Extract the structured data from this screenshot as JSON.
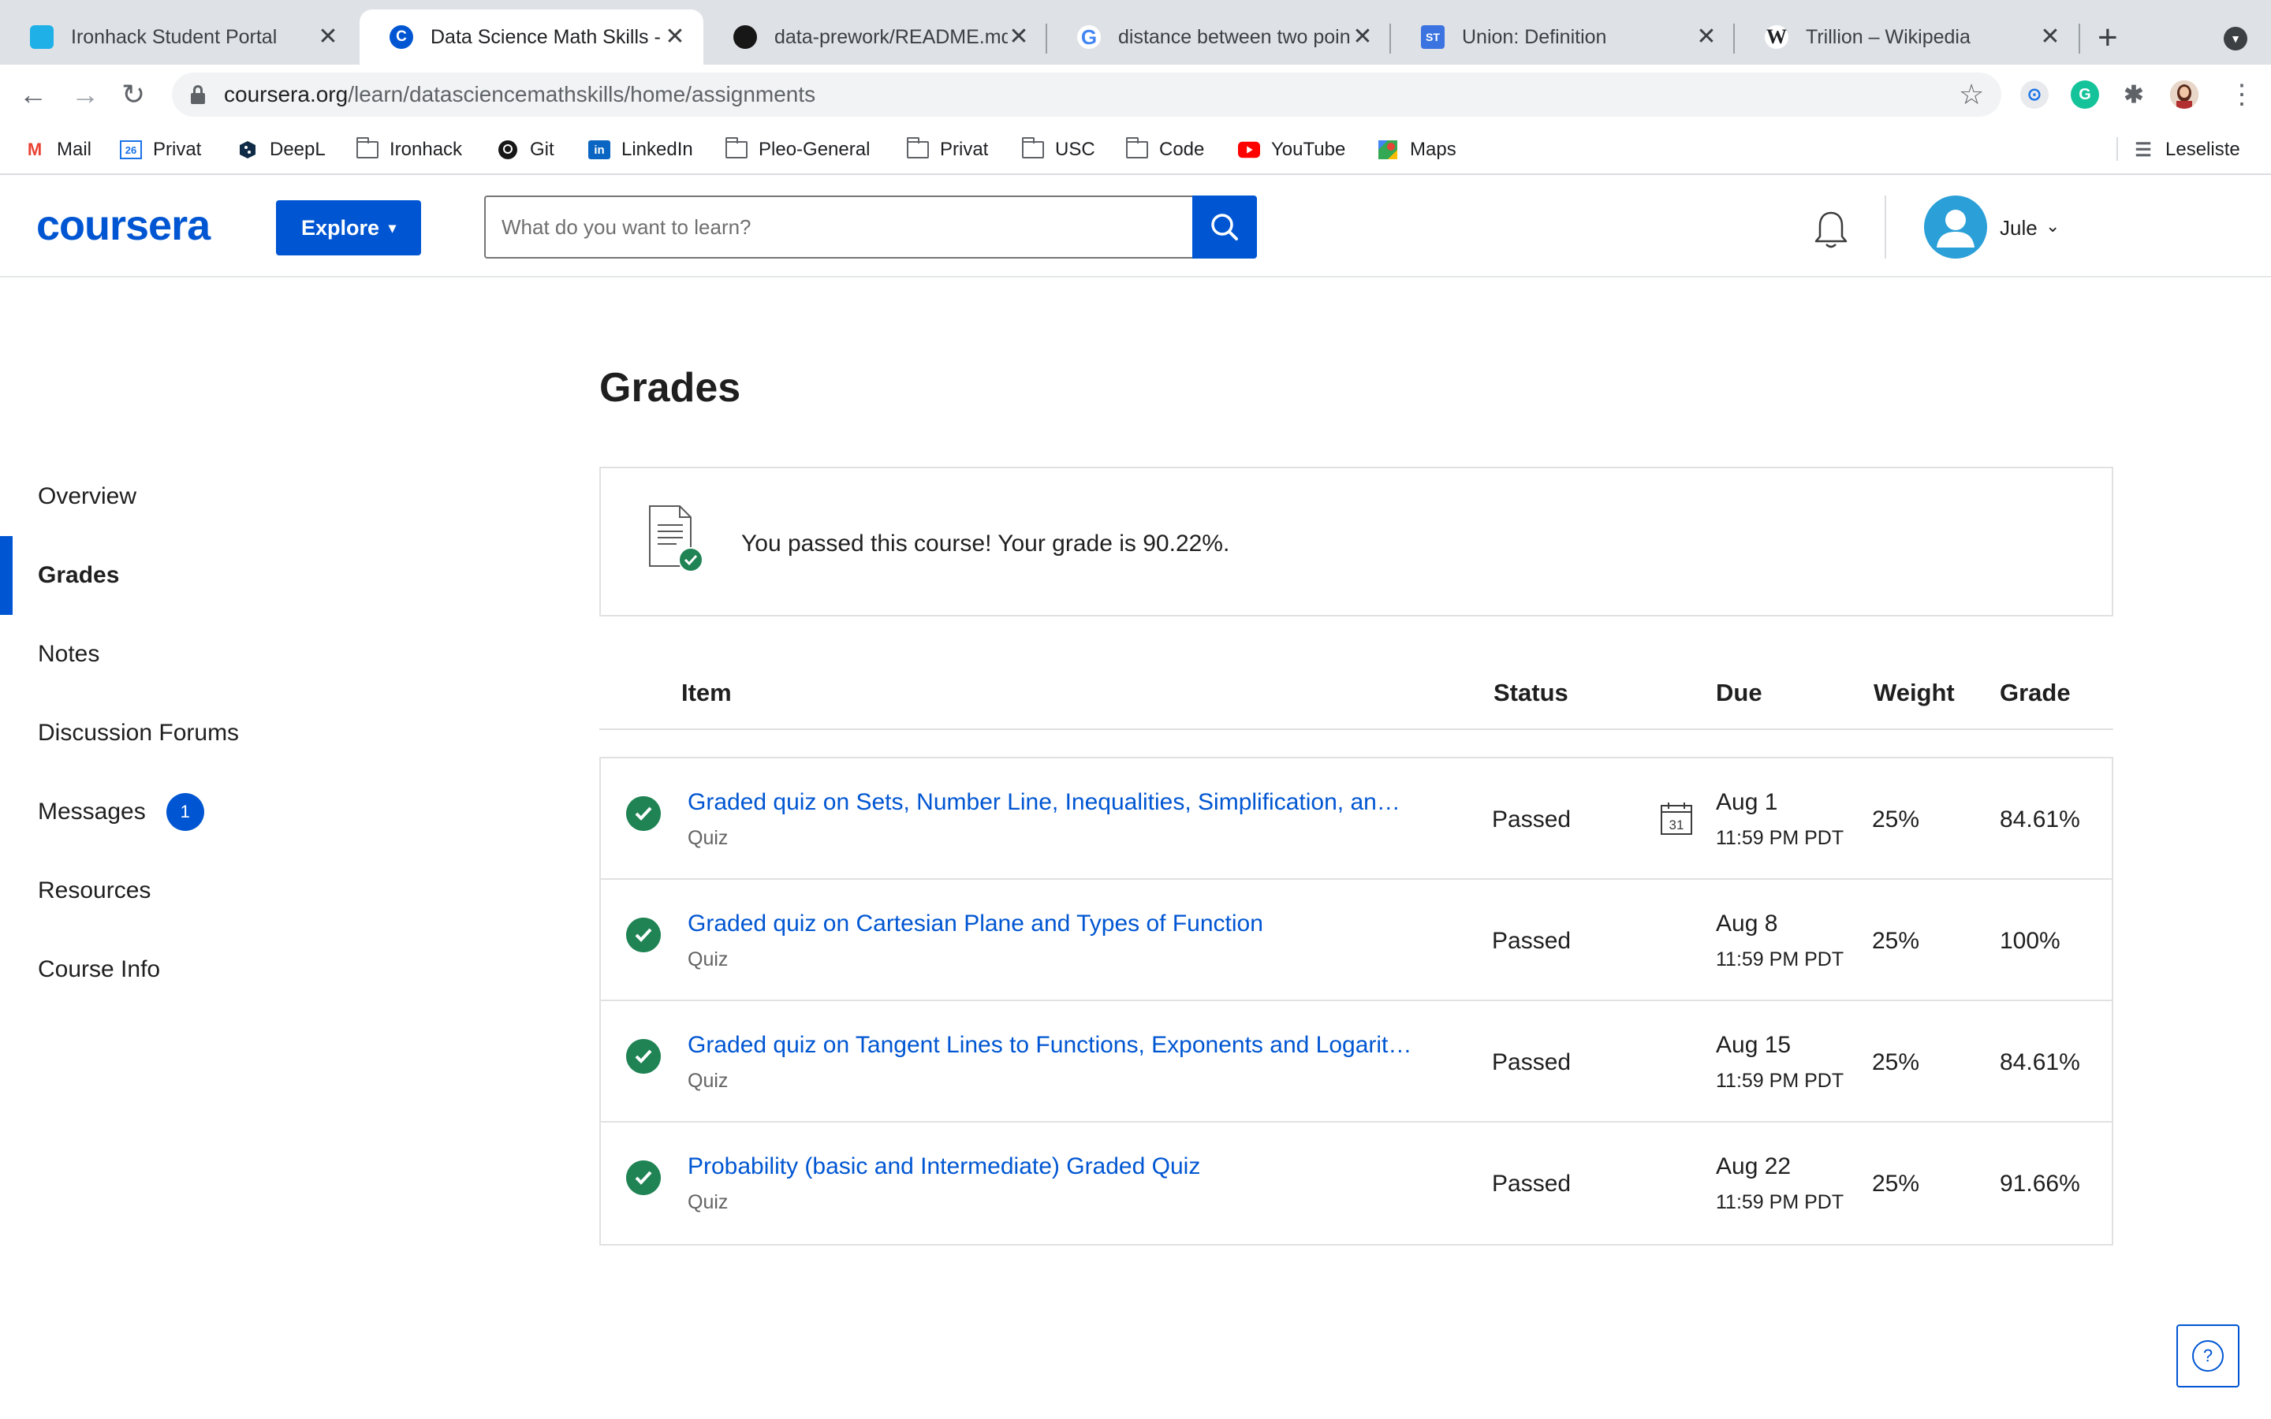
{
  "browser": {
    "tabs": [
      {
        "title": "Ironhack Student Portal",
        "favicon_color": "#1fb0e8",
        "favicon_glyph": "",
        "active": false
      },
      {
        "title": "Data Science Math Skills - C",
        "favicon_color": "#0056d2",
        "favicon_glyph": "C",
        "active": true
      },
      {
        "title": "data-prework/README.md",
        "favicon_color": "#181717",
        "favicon_glyph": "",
        "active": false
      },
      {
        "title": "distance between two poin",
        "favicon_color": "#4285f4",
        "favicon_glyph": "G",
        "active": false
      },
      {
        "title": "Union: Definition",
        "favicon_color": "#3b73e0",
        "favicon_glyph": "ST",
        "active": false
      },
      {
        "title": "Trillion – Wikipedia",
        "favicon_color": "#ffffff",
        "favicon_glyph": "W",
        "active": false
      }
    ],
    "close_glyph": "✕",
    "new_tab_glyph": "+",
    "url_domain": "coursera.org",
    "url_path": "/learn/datasciencemathskills/home/assignments",
    "bookmarks": [
      {
        "label": "Mail",
        "icon": "gmail-icon"
      },
      {
        "label": "Privat",
        "icon": "calendar-icon"
      },
      {
        "label": "DeepL",
        "icon": "deepl-icon"
      },
      {
        "label": "Ironhack",
        "icon": "folder-icon"
      },
      {
        "label": "Git",
        "icon": "github-icon"
      },
      {
        "label": "LinkedIn",
        "icon": "linkedin-icon"
      },
      {
        "label": "Pleo-General",
        "icon": "folder-icon"
      },
      {
        "label": "Privat",
        "icon": "folder-icon"
      },
      {
        "label": "USC",
        "icon": "folder-icon"
      },
      {
        "label": "Code",
        "icon": "folder-icon"
      },
      {
        "label": "YouTube",
        "icon": "youtube-icon"
      },
      {
        "label": "Maps",
        "icon": "maps-icon"
      }
    ],
    "reading_list": "Leseliste"
  },
  "header": {
    "logo": "coursera",
    "explore_label": "Explore",
    "search_placeholder": "What do you want to learn?",
    "username": "Jule",
    "brand_color": "#0056d2"
  },
  "sidebar": {
    "items": [
      {
        "label": "Overview",
        "active": false
      },
      {
        "label": "Grades",
        "active": true
      },
      {
        "label": "Notes",
        "active": false
      },
      {
        "label": "Discussion Forums",
        "active": false
      },
      {
        "label": "Messages",
        "active": false,
        "badge": "1"
      },
      {
        "label": "Resources",
        "active": false
      },
      {
        "label": "Course Info",
        "active": false
      }
    ]
  },
  "main": {
    "title": "Grades",
    "banner": "You passed this course! Your grade is 90.22%.",
    "columns": {
      "item": "Item",
      "status": "Status",
      "due": "Due",
      "weight": "Weight",
      "grade": "Grade"
    },
    "rows": [
      {
        "title": "Graded quiz on Sets, Number Line, Inequalities, Simplification, an…",
        "type": "Quiz",
        "status": "Passed",
        "due_date": "Aug 1",
        "due_time": "11:59 PM PDT",
        "weight": "25%",
        "grade": "84.61%",
        "calendar_day": "31"
      },
      {
        "title": "Graded quiz on Cartesian Plane and Types of Function",
        "type": "Quiz",
        "status": "Passed",
        "due_date": "Aug 8",
        "due_time": "11:59 PM PDT",
        "weight": "25%",
        "grade": "100%"
      },
      {
        "title": "Graded quiz on Tangent Lines to Functions, Exponents and Logarit…",
        "type": "Quiz",
        "status": "Passed",
        "due_date": "Aug 15",
        "due_time": "11:59 PM PDT",
        "weight": "25%",
        "grade": "84.61%"
      },
      {
        "title": "Probability (basic and Intermediate) Graded Quiz",
        "type": "Quiz",
        "status": "Passed",
        "due_date": "Aug 22",
        "due_time": "11:59 PM PDT",
        "weight": "25%",
        "grade": "91.66%"
      }
    ],
    "passed_color": "#1f8354",
    "help_glyph": "?"
  }
}
